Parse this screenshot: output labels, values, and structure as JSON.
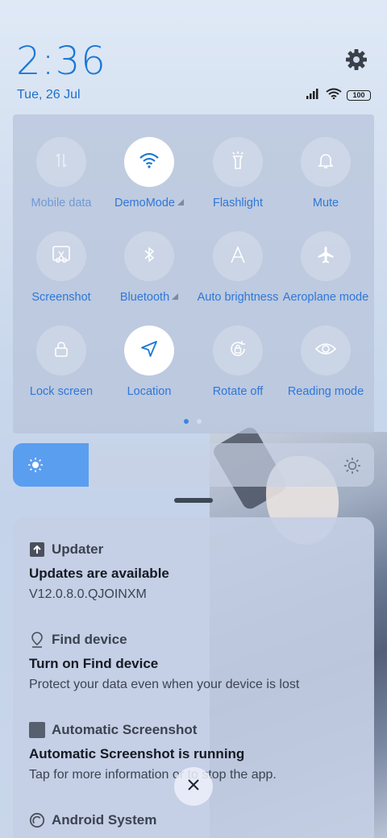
{
  "status": {
    "time": "2:36",
    "date": "Tue, 26 Jul",
    "battery_level": "100",
    "icons": [
      "signal-icon",
      "wifi-icon",
      "battery-icon"
    ]
  },
  "quick_settings": {
    "tiles": [
      {
        "label": "Mobile data",
        "icon": "mobile-data-icon",
        "active": false
      },
      {
        "label": "DemoMode",
        "icon": "wifi-icon",
        "active": true
      },
      {
        "label": "Flashlight",
        "icon": "flashlight-icon",
        "active": false
      },
      {
        "label": "Mute",
        "icon": "bell-icon",
        "active": false
      },
      {
        "label": "Screenshot",
        "icon": "screenshot-icon",
        "active": false
      },
      {
        "label": "Bluetooth",
        "icon": "bluetooth-icon",
        "active": false
      },
      {
        "label": "Auto brightness",
        "icon": "auto-brightness-icon",
        "active": false
      },
      {
        "label": "Aeroplane mode",
        "icon": "airplane-icon",
        "active": false
      },
      {
        "label": "Lock screen",
        "icon": "lock-icon",
        "active": false
      },
      {
        "label": "Location",
        "icon": "location-icon",
        "active": true
      },
      {
        "label": "Rotate off",
        "icon": "rotate-lock-icon",
        "active": false
      },
      {
        "label": "Reading mode",
        "icon": "eye-icon",
        "active": false
      }
    ],
    "page_count": 2,
    "current_page": 1
  },
  "brightness": {
    "level_fraction": 0.21
  },
  "notifications": [
    {
      "app": "Updater",
      "icon": "upload-icon",
      "title": "Updates are available",
      "body": "V12.0.8.0.QJOINXM"
    },
    {
      "app": "Find device",
      "icon": "location-pin-icon",
      "title": "Turn on Find device",
      "body": "Protect your data even when your device is lost"
    },
    {
      "app": "Automatic Screenshot",
      "icon": "app-square-icon",
      "title": "Automatic Screenshot is running",
      "body": "Tap for more information or to stop the app."
    },
    {
      "app": "Android System",
      "icon": "android-system-icon",
      "title": "",
      "body": ""
    }
  ],
  "colors": {
    "accent": "#1b78d6",
    "tile_active_bg": "#ffffff",
    "brightness_fill": "#5a9ef0"
  }
}
